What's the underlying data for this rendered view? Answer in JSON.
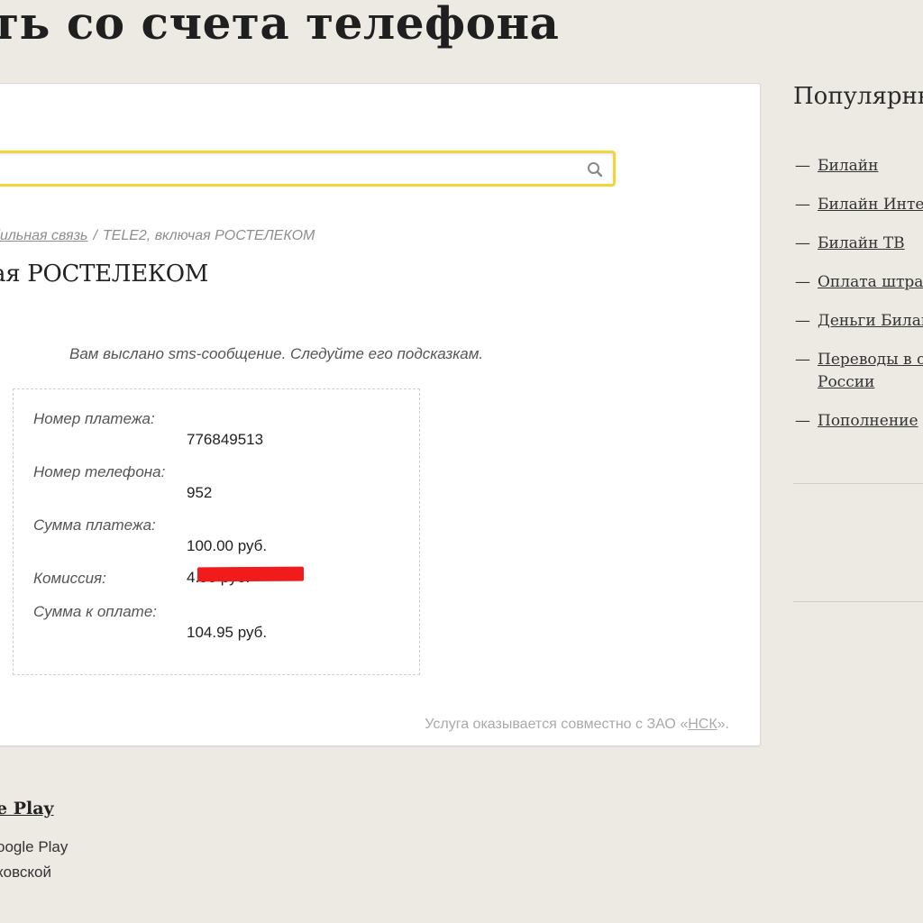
{
  "page": {
    "title": "ть со счета телефона"
  },
  "search": {
    "value": "",
    "placeholder": "",
    "icon": "search-icon"
  },
  "breadcrumb": {
    "link_label": "бильная связь",
    "separator": "/",
    "current": "TELE2, включая РОСТЕЛЕКОМ"
  },
  "provider": {
    "title": "ая РОСТЕЛЕКОМ"
  },
  "message": "Вам выслано sms-сообщение. Следуйте его подсказкам.",
  "details": [
    {
      "label": "Номер платежа:",
      "value": "776849513"
    },
    {
      "label": "Номер телефона:",
      "value": "952"
    },
    {
      "label": "Сумма платежа:",
      "value": "100.00 руб."
    },
    {
      "label": "Комиссия:",
      "value": "4.95 руб."
    },
    {
      "label": "Сумма к оплате:",
      "value": "104.95 руб."
    }
  ],
  "service_note": {
    "prefix": "Услуга оказывается совместно с ЗАО «",
    "link": "НСК",
    "suffix": "»."
  },
  "sidebar": {
    "title": "Популярны",
    "dash": "—",
    "items": [
      {
        "line1": "Билайн",
        "line2": ""
      },
      {
        "line1": "Билайн Интер",
        "line2": ""
      },
      {
        "line1": "Билайн ТВ",
        "line2": ""
      },
      {
        "line1": "Оплата штраф",
        "line2": ""
      },
      {
        "line1": "Деньги Билай",
        "line2": ""
      },
      {
        "line1": "Переводы в о",
        "line2": "России"
      },
      {
        "line1": "Пополнение",
        "line2": ""
      }
    ]
  },
  "footer": {
    "title": "e Play",
    "line1": "oogle Play",
    "line2": "ковской"
  },
  "colors": {
    "background": "#edeae4",
    "search_border": "#f3d53a",
    "redaction": "#f21b1b"
  }
}
